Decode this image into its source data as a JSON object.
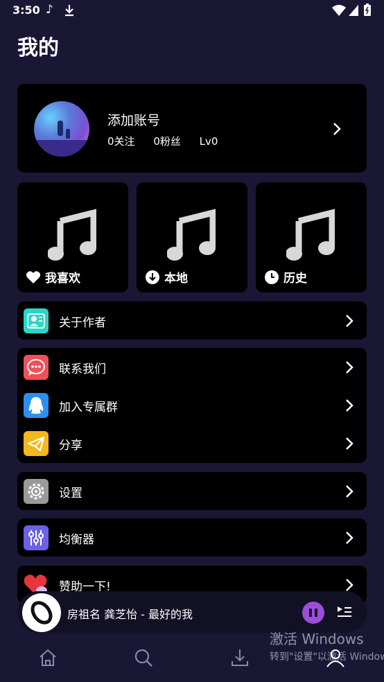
{
  "status_bar": {
    "time": "3:50"
  },
  "page": {
    "title": "我的"
  },
  "account": {
    "name": "添加账号",
    "following": "0关注",
    "fans": "0粉丝",
    "level": "Lv0"
  },
  "library": [
    {
      "label": "我喜欢",
      "icon": "heart-icon"
    },
    {
      "label": "本地",
      "icon": "download-circle-icon"
    },
    {
      "label": "历史",
      "icon": "clock-icon"
    }
  ],
  "menu": {
    "about": {
      "label": "关于作者",
      "color": "#2ad6c8"
    },
    "contact": {
      "label": "联系我们",
      "color": "#f0505a"
    },
    "group": {
      "label": "加入专属群",
      "color": "#2b8ff0"
    },
    "share": {
      "label": "分享",
      "color": "#f5b81c"
    },
    "settings": {
      "label": "设置",
      "color": "#9a9a9a"
    },
    "equalizer": {
      "label": "均衡器",
      "color": "#6a62e8"
    },
    "sponsor": {
      "label": "赞助一下!",
      "color": "#e8353d"
    }
  },
  "player": {
    "song": "房祖名 龚芝怡 - 最好的我",
    "accent": "#9b4fd8"
  },
  "watermark": {
    "line1": "激活 Windows",
    "line2": "转到\"设置\"以激活 Windows。"
  },
  "tabs": [
    "home-icon",
    "search-icon",
    "download-icon",
    "profile-icon"
  ]
}
